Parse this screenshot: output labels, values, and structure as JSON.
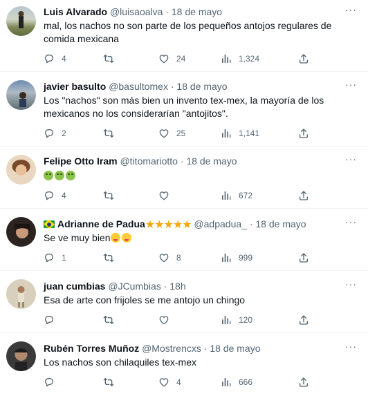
{
  "tweets": [
    {
      "name": "Luis Alvarado",
      "handle": "@luisaoalva",
      "separator": "·",
      "time": "18 de mayo",
      "text": "mal, los nachos no son parte de los pequeños antojos regulares de comida mexicana",
      "replies": "4",
      "retweets": "",
      "likes": "24",
      "views": "1,324"
    },
    {
      "name": "javier basulto",
      "handle": "@basultomex",
      "separator": "·",
      "time": "18 de mayo",
      "text": "Los \"nachos\" son más bien un invento tex-mex, la mayoría de los mexicanos no los considerarían \"antojitos\".",
      "replies": "2",
      "retweets": "",
      "likes": "25",
      "views": "1,141"
    },
    {
      "name": "Felipe Otto Iram",
      "handle": "@titomariotto",
      "separator": "·",
      "time": "18 de mayo",
      "text": "",
      "replies": "4",
      "retweets": "",
      "likes": "",
      "views": "672"
    },
    {
      "name": "Adrianne de Padua",
      "handle": "@adpadua_",
      "separator": "·",
      "time": "18 de mayo",
      "text": "Se ve muy bien",
      "replies": "1",
      "retweets": "",
      "likes": "8",
      "views": "999"
    },
    {
      "name": "juan cumbias",
      "handle": "@JCumbias",
      "separator": "·",
      "time": "18h",
      "text": "Esa de arte con frijoles se me antojo un chingo",
      "replies": "",
      "retweets": "",
      "likes": "",
      "views": "120"
    },
    {
      "name": "Rubén Torres Muñoz",
      "handle": "@Mostrencxs",
      "separator": "·",
      "time": "18 de mayo",
      "text": "Los nachos son chilaquiles tex-mex",
      "replies": "",
      "retweets": "",
      "likes": "4",
      "views": "666"
    }
  ],
  "more_label": "···",
  "icons": {
    "reply": "reply-icon",
    "retweet": "retweet-icon",
    "like": "heart-icon",
    "views": "views-icon",
    "share": "share-icon"
  },
  "colors": {
    "secondary_text": "#536471",
    "divider": "#eff3f4",
    "star": "#f4a70b"
  }
}
